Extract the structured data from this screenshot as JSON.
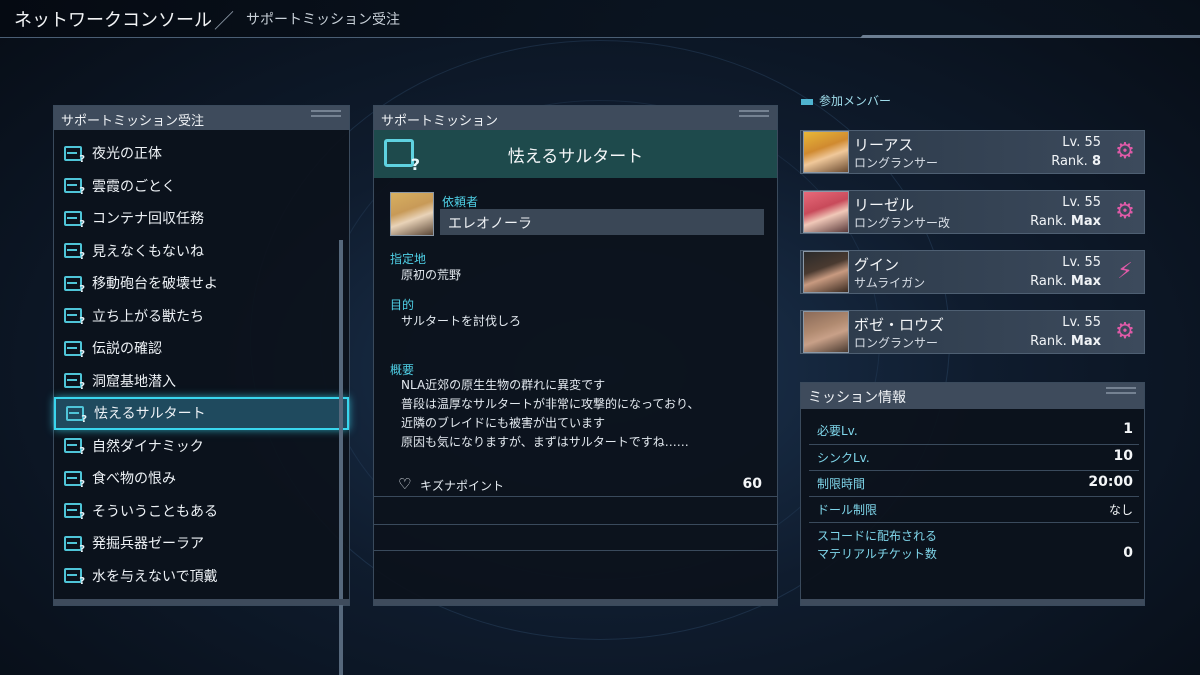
{
  "header": {
    "title": "ネットワークコンソール",
    "separator": "／",
    "subtitle": "サポートミッション受注"
  },
  "mission_list": {
    "title": "サポートミッション受注",
    "items": [
      "夜光の正体",
      "雲霞のごとく",
      "コンテナ回収任務",
      "見えなくもないね",
      "移動砲台を破壊せよ",
      "立ち上がる獣たち",
      "伝説の確認",
      "洞窟基地潜入",
      "怯えるサルタート",
      "自然ダイナミック",
      "食べ物の恨み",
      "そういうこともある",
      "発掘兵器ゼーラア",
      "水を与えないで頂戴"
    ],
    "selected_index": 8
  },
  "detail": {
    "title": "サポートミッション",
    "mission_name": "怯えるサルタート",
    "client_label": "依頼者",
    "client_name": "エレオノーラ",
    "location_label": "指定地",
    "location": "原初の荒野",
    "objective_label": "目的",
    "objective": "サルタートを討伐しろ",
    "summary_label": "概要",
    "summary_lines": [
      "NLA近郊の原生生物の群れに異変です",
      "普段は温厚なサルタートが非常に攻撃的になっており、",
      "近隣のブレイドにも被害が出ています",
      "原因も気になりますが、まずはサルタートですね……"
    ],
    "kizuna_label": "キズナポイント",
    "kizuna_value": "60"
  },
  "members": {
    "title": "参加メンバー",
    "list": [
      {
        "name": "リーアス",
        "class": "ロングランサー",
        "lv": "Lv. 55",
        "rank_prefix": "Rank. ",
        "rank": "8",
        "emblem": "⚙"
      },
      {
        "name": "リーゼル",
        "class": "ロングランサー改",
        "lv": "Lv. 55",
        "rank_prefix": "Rank. ",
        "rank": "Max",
        "emblem": "⚙"
      },
      {
        "name": "グイン",
        "class": "サムライガン",
        "lv": "Lv. 55",
        "rank_prefix": "Rank. ",
        "rank": "Max",
        "emblem": "⚡"
      },
      {
        "name": "ボゼ・ロウズ",
        "class": "ロングランサー",
        "lv": "Lv. 55",
        "rank_prefix": "Rank. ",
        "rank": "Max",
        "emblem": "⚙"
      }
    ]
  },
  "mission_info": {
    "title": "ミッション情報",
    "rows": [
      {
        "label": "必要Lv.",
        "value": "1"
      },
      {
        "label": "シンクLv.",
        "value": "10"
      },
      {
        "label": "制限時間",
        "value": "20:00"
      },
      {
        "label": "ドール制限",
        "value": "なし"
      },
      {
        "label_line1": "スコードに配布される",
        "label_line2": "マテリアルチケット数",
        "value": "0"
      }
    ]
  },
  "colors": {
    "accent_cyan": "#39d6ee",
    "panel_header": "#3e4b5c",
    "banner": "#1e4a4c",
    "emblem_pink": "#e05aa8"
  }
}
